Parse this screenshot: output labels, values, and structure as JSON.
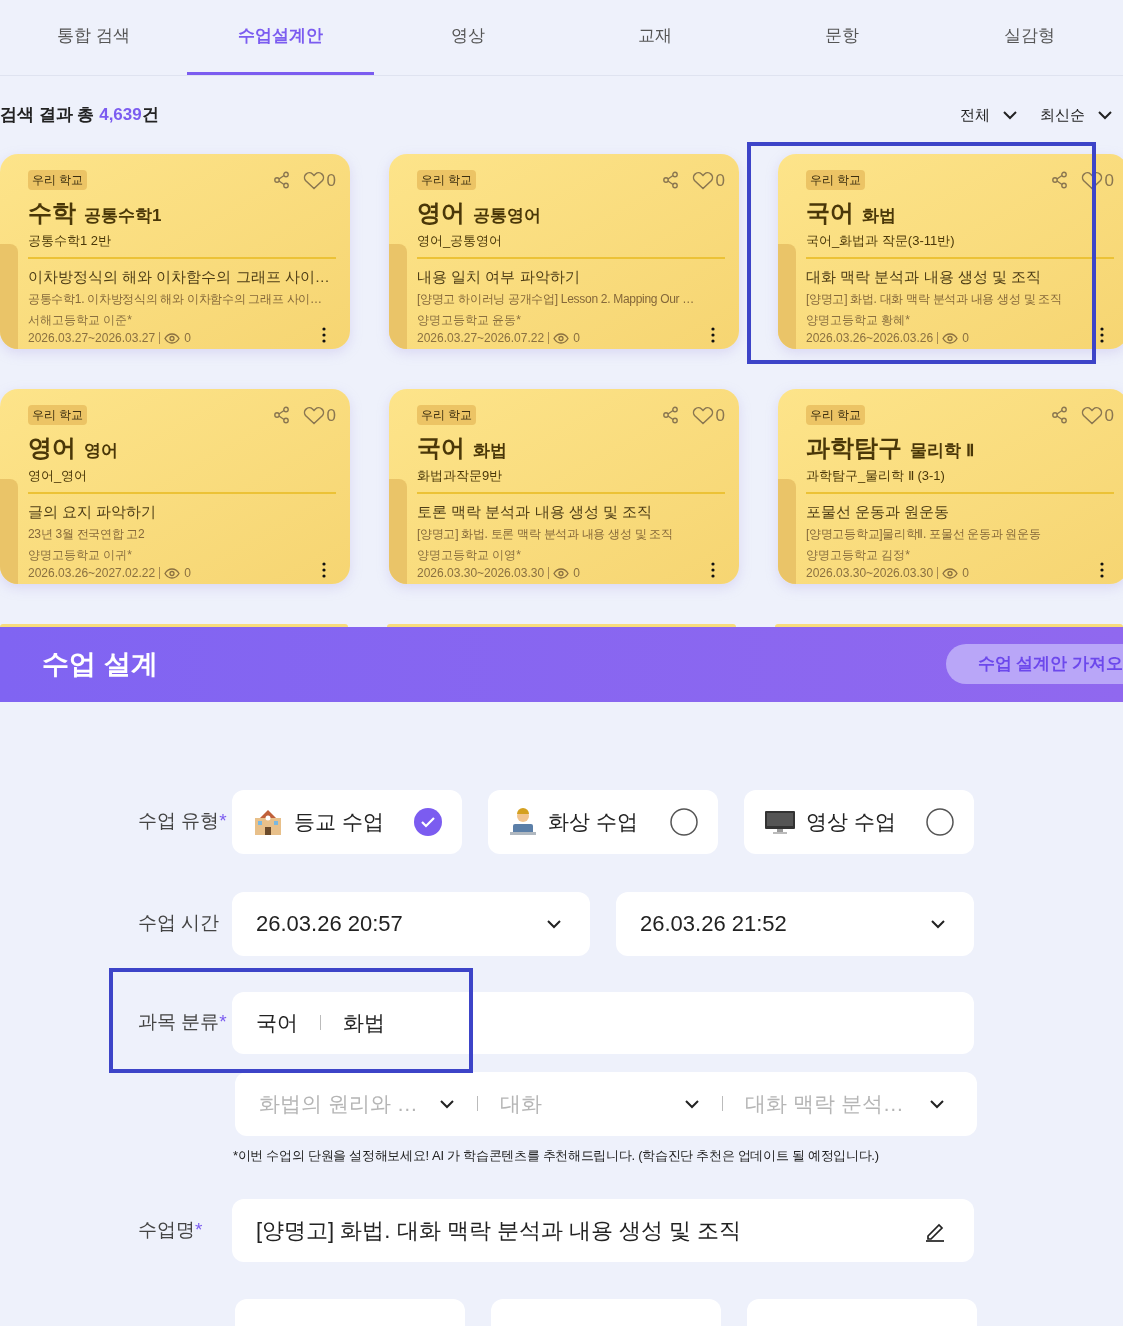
{
  "tabs": [
    {
      "label": "통합 검색",
      "selected": false
    },
    {
      "label": "수업설계안",
      "selected": true
    },
    {
      "label": "영상",
      "selected": false
    },
    {
      "label": "교재",
      "selected": false
    },
    {
      "label": "문항",
      "selected": false
    },
    {
      "label": "실감형",
      "selected": false
    }
  ],
  "results": {
    "prefix": "검색 결과 총 ",
    "count": "4,639",
    "suffix": "건",
    "filters": [
      "전체",
      "최신순"
    ]
  },
  "cards": [
    {
      "tag": "우리 학교",
      "subject": "수학",
      "course": "공통수학1",
      "class_name": "공통수학1 2반",
      "title": "이차방정식의 해와 이차함수의 그래프 사이…",
      "subtitle": "공통수학1. 이차방정식의 해와 이차함수의 그래프 사이…",
      "author": "서해고등학교 이준*",
      "period": "2026.03.27~2026.03.27",
      "views": "0",
      "likes": "0"
    },
    {
      "tag": "우리 학교",
      "subject": "영어",
      "course": "공통영어",
      "class_name": "영어_공통영어",
      "title": "내용 일치 여부 파악하기",
      "subtitle": "[양명고 하이러닝 공개수업] Lesson 2. Mapping Our …",
      "author": "양명고등학교 윤동*",
      "period": "2026.03.27~2026.07.22",
      "views": "0",
      "likes": "0"
    },
    {
      "tag": "우리 학교",
      "subject": "국어",
      "course": "화법",
      "class_name": "국어_화법과 작문(3-11반)",
      "title": "대화 맥락 분석과 내용 생성 및 조직",
      "subtitle": "[양명고] 화법. 대화 맥락 분석과 내용 생성 및 조직",
      "author": "양명고등학교 황혜*",
      "period": "2026.03.26~2026.03.26",
      "views": "0",
      "likes": "0"
    },
    {
      "tag": "우리 학교",
      "subject": "영어",
      "course": "영어",
      "class_name": "영어_영어",
      "title": "글의 요지 파악하기",
      "subtitle": "23년 3월 전국연합 고2",
      "author": "양명고등학교 이귀*",
      "period": "2026.03.26~2027.02.22",
      "views": "0",
      "likes": "0"
    },
    {
      "tag": "우리 학교",
      "subject": "국어",
      "course": "화법",
      "class_name": "화법과작문9반",
      "title": "토론 맥락 분석과 내용 생성 및 조직",
      "subtitle": "[양명고] 화법. 토론 맥락 분석과 내용 생성 및 조직",
      "author": "양명고등학교 이영*",
      "period": "2026.03.30~2026.03.30",
      "views": "0",
      "likes": "0"
    },
    {
      "tag": "우리 학교",
      "subject": "과학탐구",
      "course": "물리학 Ⅱ",
      "class_name": "과학탐구_물리학 Ⅱ (3-1)",
      "title": "포물선 운동과 원운동",
      "subtitle": "[양명고등학교]물리학Ⅱ. 포물선 운동과 원운동",
      "author": "양명고등학교 김정*",
      "period": "2026.03.30~2026.03.30",
      "views": "0",
      "likes": "0"
    }
  ],
  "banner": {
    "title": "수업 설계",
    "button": "수업 설계안 가져오"
  },
  "form": {
    "type_label": "수업 유형",
    "required_mark": "*",
    "types": [
      {
        "kind": "school",
        "label": "등교 수업",
        "selected": true
      },
      {
        "kind": "remote",
        "label": "화상 수업",
        "selected": false
      },
      {
        "kind": "video",
        "label": "영상 수업",
        "selected": false
      }
    ],
    "time_label": "수업 시간",
    "times": [
      "26.03.26 20:57",
      "26.03.26 21:52"
    ],
    "subject_label": "과목 분류",
    "subject": "국어",
    "course": "화법",
    "units": [
      {
        "placeholder": "화법의 원리와 …"
      },
      {
        "placeholder": "대화"
      },
      {
        "placeholder": "대화 맥락 분석…"
      }
    ],
    "note": "*이번 수업의 단원을 설정해보세요! AI 가 학습콘텐츠를 추천해드립니다. (학습진단 추천은 업데이트 될 예정입니다.)",
    "name_label": "수업명",
    "name_value": "[양명고] 화법. 대화 맥락 분석과 내용 생성 및 조직"
  }
}
